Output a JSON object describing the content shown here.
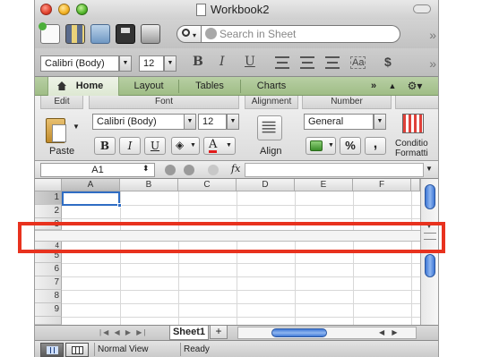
{
  "window": {
    "title": "Workbook2"
  },
  "toolbar": {
    "search_placeholder": "Search in Sheet"
  },
  "format_toolbar": {
    "font_name": "Calibri (Body)",
    "font_size": "12",
    "bold": "B",
    "italic": "I",
    "underline": "U",
    "currency": "$"
  },
  "ribbon": {
    "tabs": [
      "Home",
      "Layout",
      "Tables",
      "Charts"
    ],
    "active_tab": "Home",
    "groups": {
      "edit": "Edit",
      "font": "Font",
      "alignment": "Alignment",
      "number": "Number"
    },
    "paste_label": "Paste",
    "font_name": "Calibri (Body)",
    "font_size": "12",
    "bold": "B",
    "italic": "I",
    "underline": "U",
    "font_color": "A",
    "align_label": "Align",
    "number_format": "General",
    "percent": "%",
    "comma": ",",
    "conditional_label_line1": "Conditio",
    "conditional_label_line2": "Formatti"
  },
  "formula_bar": {
    "name_box": "A1",
    "fx": "fx",
    "formula": ""
  },
  "grid": {
    "columns": [
      "A",
      "B",
      "C",
      "D",
      "E",
      "F"
    ],
    "top_rows": [
      "1",
      "2",
      "3"
    ],
    "bottom_rows": [
      "4",
      "5",
      "6",
      "7",
      "8",
      "9"
    ],
    "selected_cell": "A1"
  },
  "sheet_tabs": {
    "tabs": [
      "Sheet1"
    ],
    "add": "+"
  },
  "status_bar": {
    "view": "Normal View",
    "state": "Ready"
  },
  "colors": {
    "ribbon_tab_bar": "#9fbd86",
    "selection": "#2f6dc4",
    "annotation_red": "#e8321e",
    "scroll_thumb": "#3f78d6"
  }
}
